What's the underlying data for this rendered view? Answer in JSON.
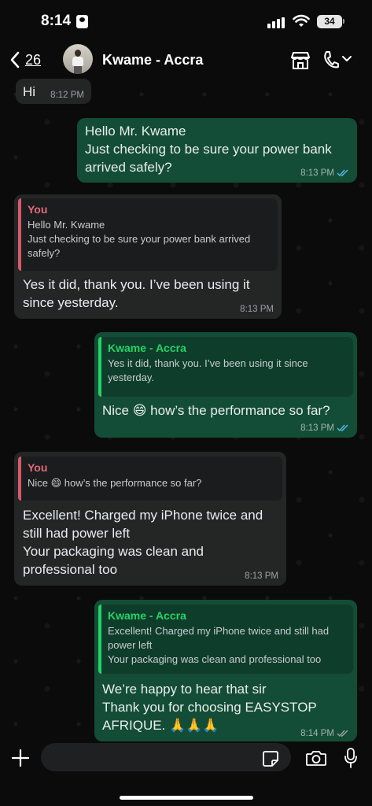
{
  "status_bar": {
    "time": "8:14",
    "battery": "34"
  },
  "header": {
    "back_count": "26",
    "contact_name": "Kwame - Accra"
  },
  "messages": [
    {
      "text": "Hi",
      "time": "8:12 PM"
    },
    {
      "text": "Hello Mr. Kwame\nJust checking to be sure your power bank\narrived safely?",
      "time": "8:13 PM"
    },
    {
      "quote_author": "You",
      "quote_text": "Hello Mr. Kwame\nJust checking to be sure your power bank arrived\nsafely?",
      "text": "Yes it did, thank you. I’ve been using it\nsince yesterday.",
      "time": "8:13 PM"
    },
    {
      "quote_author": "Kwame - Accra",
      "quote_text": "Yes it did, thank you. I’ve been using it since\nyesterday.",
      "text": "Nice 😄 how’s the performance so far?",
      "time": "8:13 PM"
    },
    {
      "quote_author": "You",
      "quote_text": "Nice 😄 how’s the performance so far?",
      "text": "Excellent! Charged my iPhone twice and\nstill had power left\nYour packaging was clean and\nprofessional too",
      "time": "8:13 PM"
    },
    {
      "quote_author": "Kwame - Accra",
      "quote_text": "Excellent! Charged my iPhone twice and still had\npower left\nYour packaging was clean and professional too",
      "text": "We’re happy to hear that sir\nThank you for choosing EASYSTOP\nAFRIQUE. 🙏🙏🙏",
      "time": "8:14 PM"
    }
  ],
  "colors": {
    "outgoing_bubble": "#144d37",
    "incoming_bubble": "#242626",
    "reply_bar_you": "#d8596b",
    "reply_bar_contact": "#25d366"
  },
  "icons": [
    "back-chevron-icon",
    "shop-icon",
    "phone-icon",
    "chevron-down-icon",
    "plus-icon",
    "sticker-icon",
    "camera-icon",
    "mic-icon",
    "double-check-icon"
  ]
}
